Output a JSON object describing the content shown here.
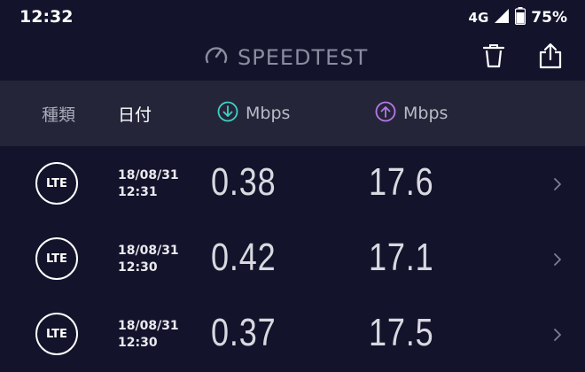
{
  "status": {
    "time": "12:32",
    "network": "4G",
    "battery": "75%"
  },
  "app": {
    "title": "SPEEDTEST",
    "icons": {
      "logo": "speedometer-icon",
      "delete": "trash-icon",
      "share": "share-icon"
    }
  },
  "columns": {
    "type": "種類",
    "date": "日付",
    "download_unit": "Mbps",
    "upload_unit": "Mbps"
  },
  "colors": {
    "background": "#13142b",
    "header_band": "#242539",
    "download_accent": "#3fd0c6",
    "upload_accent": "#b877e8",
    "title_gray": "#8a8d9f"
  },
  "results": [
    {
      "type": "LTE",
      "date": "18/08/31",
      "time": "12:31",
      "download": "0.38",
      "upload": "17.6"
    },
    {
      "type": "LTE",
      "date": "18/08/31",
      "time": "12:30",
      "download": "0.42",
      "upload": "17.1"
    },
    {
      "type": "LTE",
      "date": "18/08/31",
      "time": "12:30",
      "download": "0.37",
      "upload": "17.5"
    }
  ]
}
